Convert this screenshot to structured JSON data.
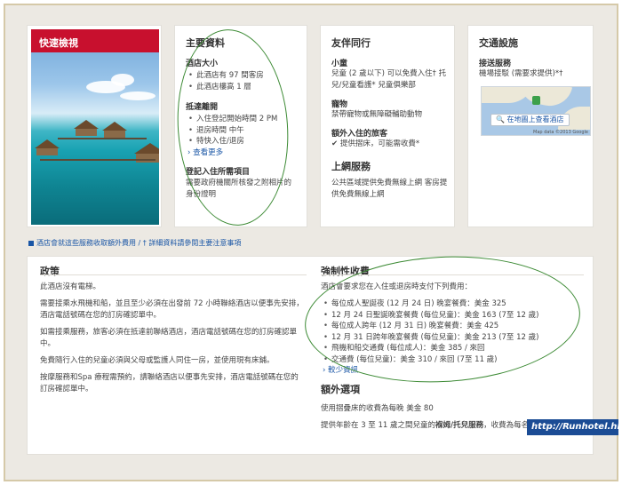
{
  "quick_view": {
    "title": "快速檢視"
  },
  "hotel_info": {
    "title": "主要資料",
    "size_heading": "酒店大小",
    "size_items": [
      "此酒店有 97 間客房",
      "此酒店樓高 1 層"
    ],
    "arrival_heading": "抵達離開",
    "arrival_items": [
      "入住登記開始時間 2 PM",
      "退房時間 中午",
      "特快入住/退房"
    ],
    "more_link": "查看更多",
    "checkin_heading": "登記入住所需項目",
    "checkin_text": "需要政府機關所核發之附相片的身份證明"
  },
  "travel_companions": {
    "title": "友伴同行",
    "kids_heading": "小童",
    "kids_text": "兒童 (2 歲以下) 可以免費入住† 托兒/兒童看護* 兒童俱樂部",
    "pets_heading": "寵物",
    "pets_text": "禁帶寵物或無障礙輔助動物",
    "extra_heading": "額外入住的旅客",
    "extra_text": "提供摺床，可能需收費*",
    "internet_title": "上網服務",
    "internet_text": "公共區域提供免費無線上網 客房提供免費無線上網"
  },
  "transport": {
    "title": "交通設施",
    "shuttle_heading": "接送服務",
    "shuttle_text": "機場接駁 (需要求提供)*†",
    "map_button": "在地圖上查看酒店",
    "map_credit": "Map data ©2013 Google",
    "search_icon": "search-icon"
  },
  "notice": "酒店會就這些服務收取額外費用 / † 詳細資料請參閱主要注意事項",
  "policy": {
    "title": "政策",
    "paragraphs": [
      "此酒店沒有電梯。",
      "需要接乘水飛機和船，並且至少必須在出發前 72 小時聯絡酒店以便事先安排，酒店電話號碼在您的訂房確認單中。",
      "如需接乘服務，旅客必須在抵達前聯絡酒店，酒店電話號碼在您的訂房確認單中。",
      "免費隨行入住的兒童必須與父母或監護人同住一房，並使用現有床鋪。",
      "按摩服務和Spa 療程需預約，請聯絡酒店以便事先安排，酒店電話號碼在您的訂房確認單中。"
    ]
  },
  "mandatory_fees": {
    "title": "強制性收費",
    "intro": "酒店會要求您在入住或退房時支付下列費用：",
    "items": [
      "每位成人聖誕夜 (12 月 24 日) 晚宴餐費：美金 325",
      "12 月 24 日聖誕晚宴餐費 (每位兒童)：美金 163 (7至 12 歲)",
      "每位成人跨年 (12 月 31 日) 晚宴餐費：美金 425",
      "12 月 31 日跨年晚宴餐費 (每位兒童)：美金 213 (7至 12 歲)",
      "飛機和船交通費 (每位成人)：美金 385 / 來回",
      "交通費 (每位兒童)：美金 310 / 來回 (7至 11 歲)"
    ],
    "more_link": "較少資訊"
  },
  "extra_options": {
    "title": "額外選項",
    "line1": "使用摺疊床的收費為每晚 美金 80",
    "line2_prefix": "提供年齡在 3 至 11 歲之間兒童的",
    "line2_bold": "褓姆/托兒服務",
    "line2_suffix": "，收費為每名 美金 15"
  },
  "watermark": "http://Runhotel.hk",
  "colors": {
    "accent_red": "#c8102e",
    "link_blue": "#1a56a6",
    "annotation_green": "#3c8a34",
    "watermark_bg": "#1b4c95"
  }
}
